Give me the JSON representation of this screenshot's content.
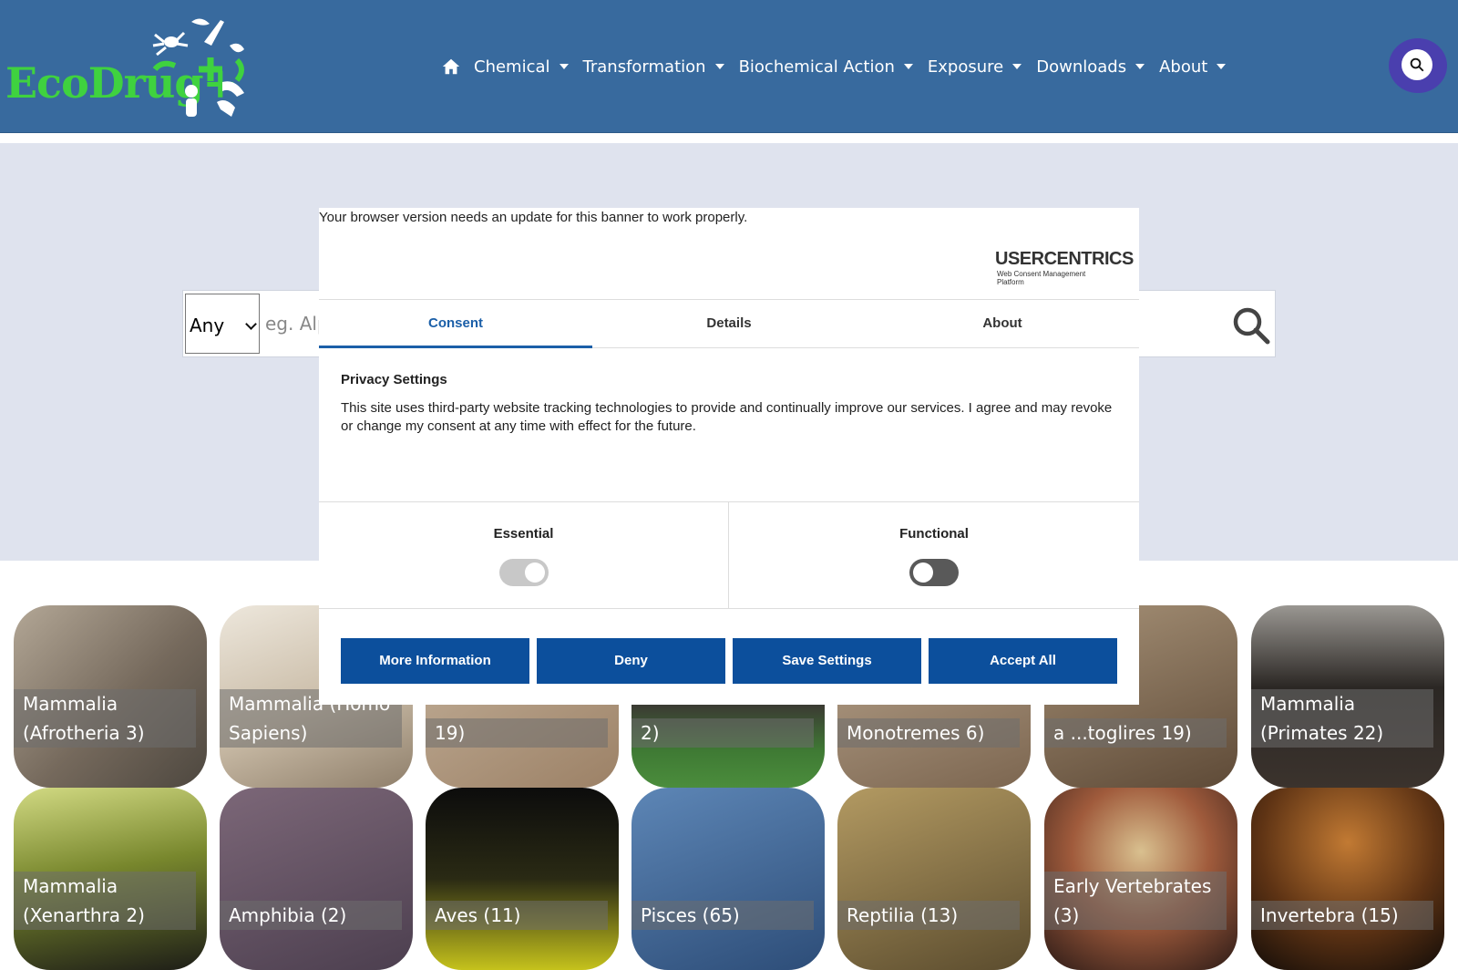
{
  "brand": {
    "logo_text": "EcoDrug+",
    "color": "#3fd23f"
  },
  "nav": {
    "items": [
      "Chemical",
      "Transformation",
      "Biochemical Action",
      "Exposure",
      "Downloads",
      "About"
    ]
  },
  "search": {
    "select_value": "Any",
    "placeholder": "eg. Alp"
  },
  "cards": [
    {
      "label": "Mammalia (Afrotheria 3)"
    },
    {
      "label": "Mammalia (Homo Sapiens)"
    },
    {
      "label": "19)"
    },
    {
      "label": "2)"
    },
    {
      "label": "Monotremes 6)"
    },
    {
      "label": "a ...toglires 19)"
    },
    {
      "label": "Mammalia (Primates 22)"
    },
    {
      "label": "Mammalia (Xenarthra 2)"
    },
    {
      "label": "Amphibia (2)"
    },
    {
      "label": "Aves (11)"
    },
    {
      "label": "Pisces (65)"
    },
    {
      "label": "Reptilia (13)"
    },
    {
      "label": "Early Vertebrates (3)"
    },
    {
      "label": "Invertebra (15)"
    }
  ],
  "consent": {
    "warning": "Your browser version needs an update for this banner to work properly.",
    "brand_title": "USERCENTRICS",
    "brand_sub": "Web Consent Management Platform",
    "tabs": [
      "Consent",
      "Details",
      "About"
    ],
    "heading": "Privacy Settings",
    "body": "This site uses third-party website tracking technologies to provide and continually improve our services. I agree and may revoke or change my consent at any time with effect for the future.",
    "categories": [
      {
        "name": "Essential",
        "enabled": true,
        "locked": true
      },
      {
        "name": "Functional",
        "enabled": false,
        "locked": false
      }
    ],
    "buttons": [
      "More Information",
      "Deny",
      "Save Settings",
      "Accept All"
    ],
    "accent": "#0c4f9c"
  }
}
